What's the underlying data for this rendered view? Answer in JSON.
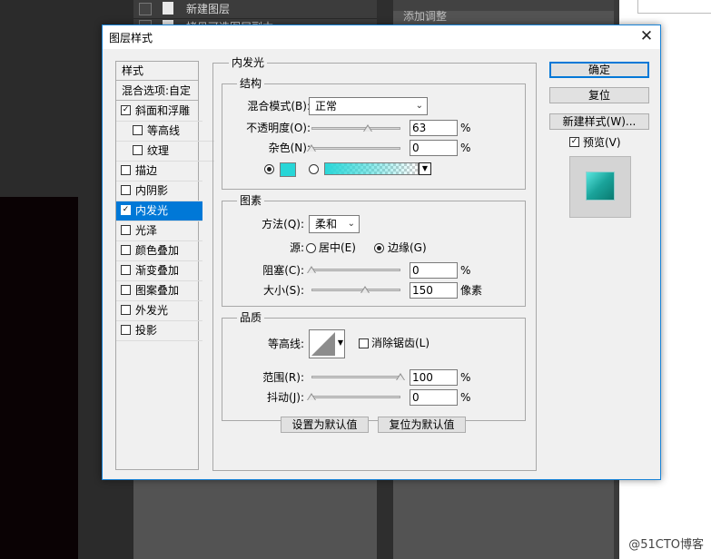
{
  "background": {
    "layers": [
      "新建图层",
      "拷贝可选图层副本"
    ],
    "adjust_label": "添加调整",
    "watermark": "@51CTO博客"
  },
  "dialog": {
    "title": "图层样式",
    "close_glyph": "✕"
  },
  "styles_list": {
    "header": "样式",
    "blend_options": "混合选项:自定",
    "items": [
      {
        "label": "斜面和浮雕",
        "checked": true
      },
      {
        "label": "等高线",
        "checked": false
      },
      {
        "label": "纹理",
        "checked": false
      },
      {
        "label": "描边",
        "checked": false
      },
      {
        "label": "内阴影",
        "checked": false
      },
      {
        "label": "内发光",
        "checked": true,
        "selected": true
      },
      {
        "label": "光泽",
        "checked": false
      },
      {
        "label": "颜色叠加",
        "checked": false
      },
      {
        "label": "渐变叠加",
        "checked": false
      },
      {
        "label": "图案叠加",
        "checked": false
      },
      {
        "label": "外发光",
        "checked": false
      },
      {
        "label": "投影",
        "checked": false
      }
    ]
  },
  "inner_glow": {
    "title": "内发光",
    "structure": {
      "title": "结构",
      "blend_mode_label": "混合模式(B):",
      "blend_mode_value": "正常",
      "opacity_label": "不透明度(O):",
      "opacity_value": "63",
      "opacity_unit": "%",
      "opacity_fraction": 0.63,
      "noise_label": "杂色(N):",
      "noise_value": "0",
      "noise_unit": "%",
      "noise_fraction": 0.0,
      "glow_color": "#27d6d7"
    },
    "elements": {
      "title": "图素",
      "technique_label": "方法(Q):",
      "technique_value": "柔和",
      "source_label": "源:",
      "source_center": "居中(E)",
      "source_edge": "边缘(G)",
      "choke_label": "阻塞(C):",
      "choke_value": "0",
      "choke_unit": "%",
      "choke_fraction": 0.0,
      "size_label": "大小(S):",
      "size_value": "150",
      "size_unit": "像素",
      "size_fraction": 0.6
    },
    "quality": {
      "title": "品质",
      "contour_label": "等高线:",
      "anti_alias_label": "消除锯齿(L)",
      "range_label": "范围(R):",
      "range_value": "100",
      "range_unit": "%",
      "range_fraction": 1.0,
      "jitter_label": "抖动(J):",
      "jitter_value": "0",
      "jitter_unit": "%",
      "jitter_fraction": 0.0
    },
    "make_default": "设置为默认值",
    "reset_default": "复位为默认值"
  },
  "buttons": {
    "ok": "确定",
    "reset": "复位",
    "new_style": "新建样式(W)...",
    "preview_label": "预览(V)",
    "preview_checked": true
  }
}
